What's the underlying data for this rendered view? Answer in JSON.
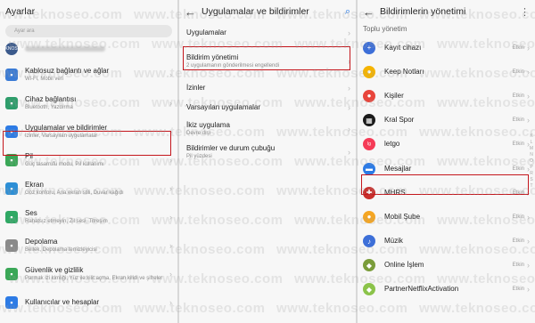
{
  "watermark": "www.teknoseo.com",
  "panel1": {
    "title": "Ayarlar",
    "search_placeholder": "Ayar ara",
    "account_logo": "TEKNOSEO",
    "items": [
      {
        "title": "Kablosuz bağlantı ve ağlar",
        "subtitle": "Wi-Fi, Mobil veri",
        "icon": "wifi-icon",
        "color": "#3a7bd5"
      },
      {
        "title": "Cihaz bağlantısı",
        "subtitle": "Bluetooth, Yazdırma",
        "icon": "device-connection-icon",
        "color": "#2e9d6b"
      },
      {
        "title": "Uygulamalar ve bildirimler",
        "subtitle": "İzinler, Varsayılan uygulamalar",
        "icon": "apps-icon",
        "color": "#2d7be5"
      },
      {
        "title": "Pil",
        "subtitle": "Güç tasarrufu modu, Pil kullanımı",
        "icon": "battery-icon",
        "color": "#3aa757"
      },
      {
        "title": "Ekran",
        "subtitle": "Göz konforu, Ana ekran stili, Duvar kağıdı",
        "icon": "display-icon",
        "color": "#2d8fd6"
      },
      {
        "title": "Ses",
        "subtitle": "Rahatsız etmeyin, Zil sesi, Titreşim",
        "icon": "sound-icon",
        "color": "#2fa864"
      },
      {
        "title": "Depolama",
        "subtitle": "Bellek, Depolama temizleyicisi",
        "icon": "storage-icon",
        "color": "#8a8a8a"
      },
      {
        "title": "Güvenlik ve gizlilik",
        "subtitle": "Parmak izi kimliği, Yüz ile kilit açma, Ekran kilidi ve şifreler",
        "icon": "shield-icon",
        "color": "#3aa757"
      },
      {
        "title": "Kullanıcılar ve hesaplar",
        "subtitle": "",
        "icon": "user-icon",
        "color": "#2d7be5"
      }
    ]
  },
  "panel2": {
    "title": "Uygulamalar ve bildirimler",
    "items": [
      {
        "title": "Uygulamalar",
        "subtitle": ""
      },
      {
        "title": "Bildirim yönetimi",
        "subtitle": "2 uygulamanın gönderilmesi engellendi"
      },
      {
        "title": "İzinler",
        "subtitle": ""
      },
      {
        "title": "Varsayılan uygulamalar",
        "subtitle": ""
      },
      {
        "title": "İkiz uygulama",
        "subtitle": "Devre dışı"
      },
      {
        "title": "Bildirimler ve durum çubuğu",
        "subtitle": "Pil yüzdesi"
      }
    ]
  },
  "panel3": {
    "title": "Bildirimlerin yönetimi",
    "section": "Toplu yönetim",
    "status_label": "Etkin",
    "apps": [
      {
        "name": "Kayıt cihazı",
        "icon": "recorder-icon",
        "color": "#3d6fd8",
        "glyph": "+"
      },
      {
        "name": "Keep Notları",
        "icon": "keep-notes-icon",
        "color": "#f5b400",
        "glyph": "●"
      },
      {
        "name": "Kişiler",
        "icon": "contacts-icon",
        "color": "#e8453c",
        "glyph": "●"
      },
      {
        "name": "Kral Spor",
        "icon": "kral-spor-icon",
        "color": "#1b1b1b",
        "glyph": "▦"
      },
      {
        "name": "letgo",
        "icon": "letgo-icon",
        "color": "#f53b57",
        "glyph": "lg"
      },
      {
        "name": "Mesajlar",
        "icon": "messages-icon",
        "color": "#2d7be5",
        "glyph": "▬"
      },
      {
        "name": "MHRS",
        "icon": "mhrs-icon",
        "color": "#c9302c",
        "glyph": "✚"
      },
      {
        "name": "Mobil Şube",
        "icon": "mobil-sube-icon",
        "color": "#f5a623",
        "glyph": "●"
      },
      {
        "name": "Müzik",
        "icon": "music-icon",
        "color": "#3d6fd8",
        "glyph": "♪"
      },
      {
        "name": "Online İşlem",
        "icon": "online-islem-icon",
        "color": "#7a9c3a",
        "glyph": "◆"
      },
      {
        "name": "PartnerNetflixActivation",
        "icon": "android-icon",
        "color": "#8bc34a",
        "glyph": "◆"
      }
    ],
    "index_letters": [
      "K",
      "L",
      "M",
      "N",
      "O",
      "P",
      "R",
      "S",
      "T"
    ]
  }
}
